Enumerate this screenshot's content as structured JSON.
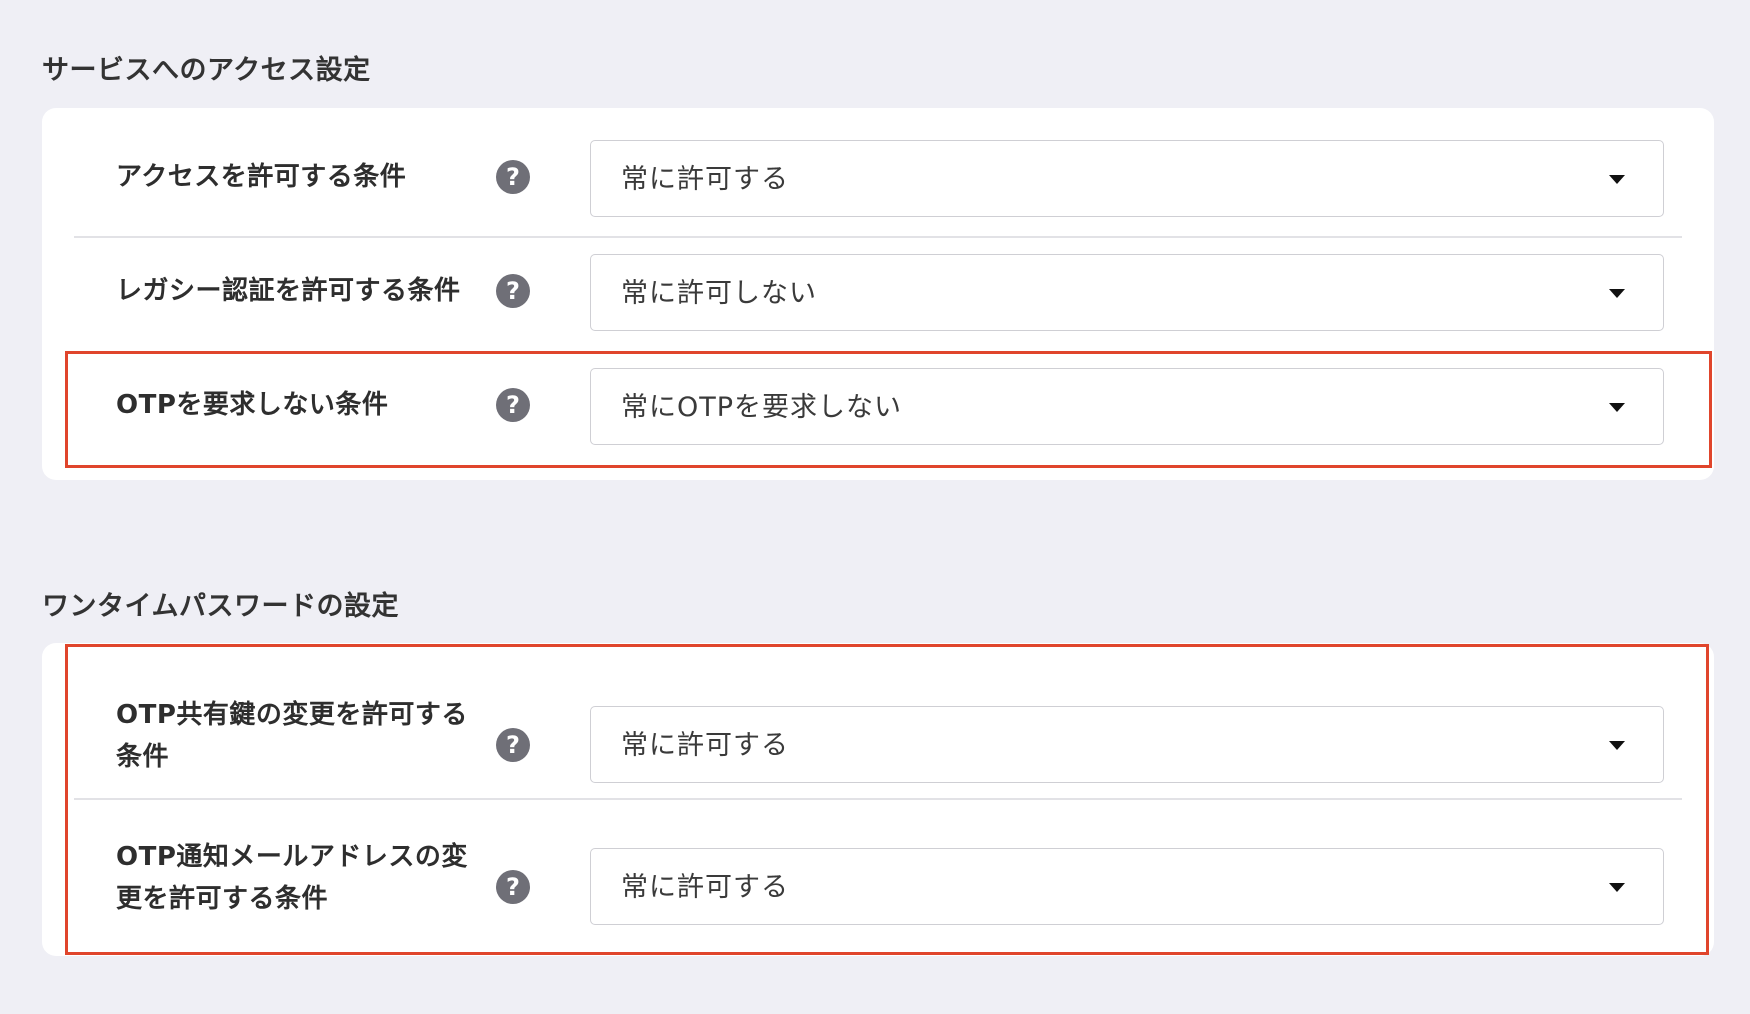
{
  "sections": [
    {
      "title": "サービスへのアクセス設定",
      "rows": [
        {
          "label": "アクセスを許可する条件",
          "value": "常に許可する"
        },
        {
          "label": "レガシー認証を許可する条件",
          "value": "常に許可しない"
        },
        {
          "label": "OTPを要求しない条件",
          "value": "常にOTPを要求しない"
        }
      ]
    },
    {
      "title": "ワンタイムパスワードの設定",
      "rows": [
        {
          "label": "OTP共有鍵の変更を許可する条件",
          "value": "常に許可する"
        },
        {
          "label": "OTP通知メールアドレスの変更を許可する条件",
          "value": "常に許可する"
        }
      ]
    }
  ],
  "help_glyph": "?",
  "icons": {
    "help": "question-circle-icon",
    "dropdown": "caret-down-icon"
  },
  "colors": {
    "background": "#efeff5",
    "card": "#ffffff",
    "highlight": "#e0452c",
    "help_icon": "#6f6f77"
  }
}
